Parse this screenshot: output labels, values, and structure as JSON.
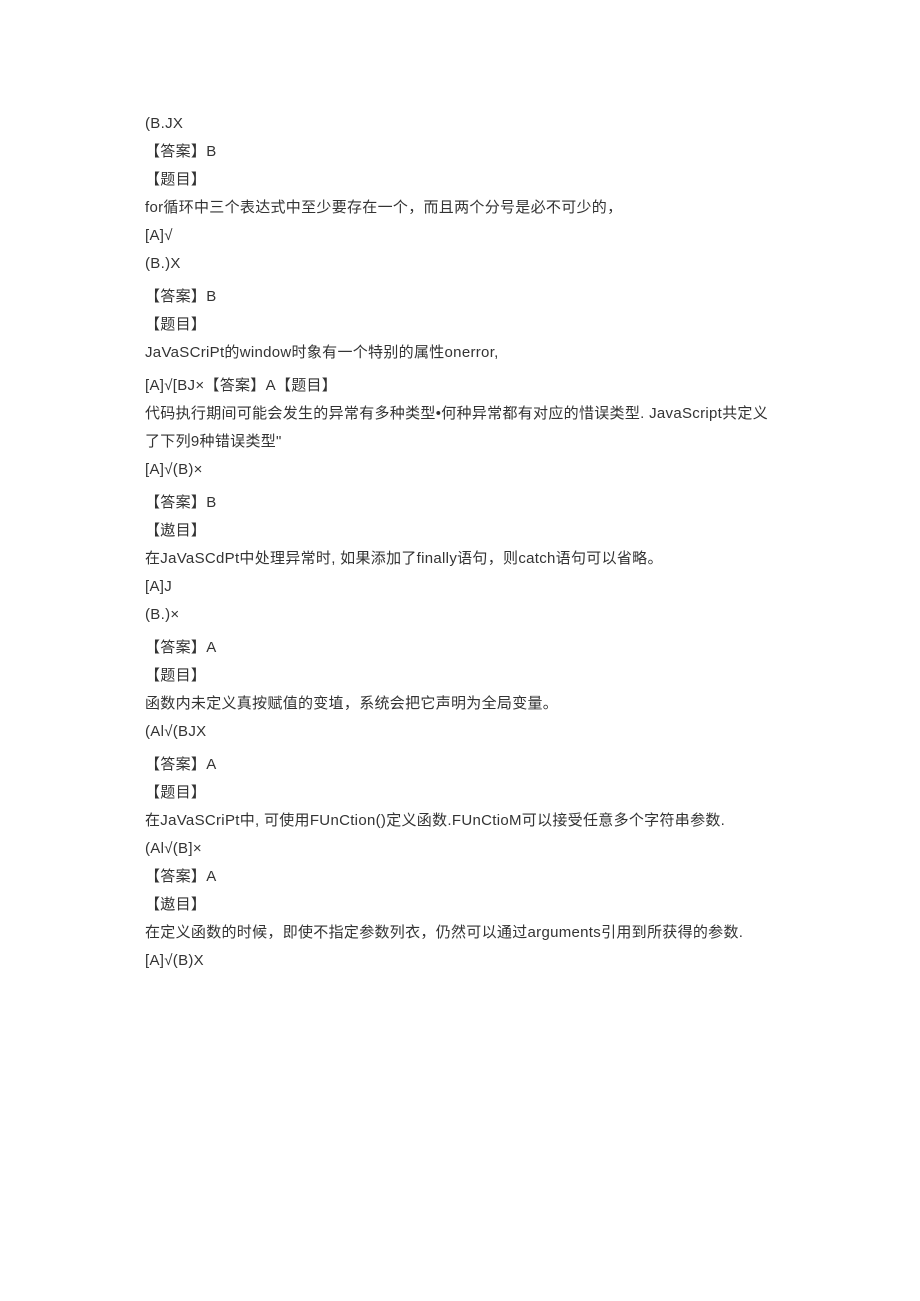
{
  "lines": [
    "(B.JX",
    "【答案】B",
    "【题目】",
    "for循环中三个表达式中至少要存在一个，而且两个分号是必不可少的，",
    "[A]√",
    "(B.)X",
    "",
    "【答案】B",
    "【题目】",
    "JaVaSCriPt的window时象有一个特别的属性onerror,",
    "",
    "[A]√[BJ×【答案】A【题目】",
    "代码执行期间可能会发生的异常有多种类型•何种异常都有对应的惜误类型. JavaScript共定义了下列9种错误类型\"",
    "[A]√(B)×",
    "",
    "【答案】B",
    "【遨目】",
    "在JaVaSCdPt中处理异常时, 如果添加了finally语句，则catch语句可以省略。",
    "[A]J",
    "(B.)×",
    "",
    "【答案】A",
    "【题目】",
    "函数内未定义真按赋值的变埴，系统会把它声明为全局变量。",
    "(Al√(BJX",
    "",
    "【答案】A",
    "【题目】",
    "在JaVaSCriPt中, 可使用FUnCtion()定义函数.FUnCtioM可以接受任意多个字符串参数. (Al√(B]×",
    "【答案】A",
    "【遨目】",
    "在定义函数的时候，即使不指定参数列衣，仍然可以通过arguments引用到所获得的参数. [A]√(B)X"
  ]
}
